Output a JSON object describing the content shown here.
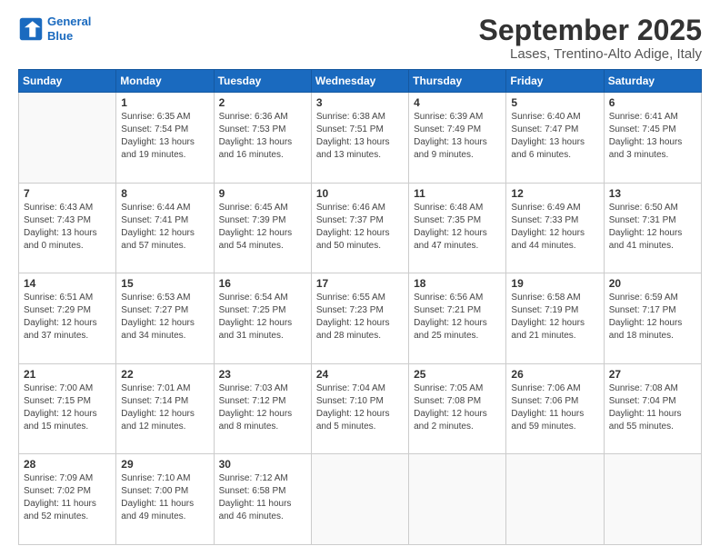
{
  "logo": {
    "line1": "General",
    "line2": "Blue"
  },
  "title": "September 2025",
  "subtitle": "Lases, Trentino-Alto Adige, Italy",
  "headers": [
    "Sunday",
    "Monday",
    "Tuesday",
    "Wednesday",
    "Thursday",
    "Friday",
    "Saturday"
  ],
  "weeks": [
    [
      {
        "day": "",
        "detail": ""
      },
      {
        "day": "1",
        "detail": "Sunrise: 6:35 AM\nSunset: 7:54 PM\nDaylight: 13 hours\nand 19 minutes."
      },
      {
        "day": "2",
        "detail": "Sunrise: 6:36 AM\nSunset: 7:53 PM\nDaylight: 13 hours\nand 16 minutes."
      },
      {
        "day": "3",
        "detail": "Sunrise: 6:38 AM\nSunset: 7:51 PM\nDaylight: 13 hours\nand 13 minutes."
      },
      {
        "day": "4",
        "detail": "Sunrise: 6:39 AM\nSunset: 7:49 PM\nDaylight: 13 hours\nand 9 minutes."
      },
      {
        "day": "5",
        "detail": "Sunrise: 6:40 AM\nSunset: 7:47 PM\nDaylight: 13 hours\nand 6 minutes."
      },
      {
        "day": "6",
        "detail": "Sunrise: 6:41 AM\nSunset: 7:45 PM\nDaylight: 13 hours\nand 3 minutes."
      }
    ],
    [
      {
        "day": "7",
        "detail": "Sunrise: 6:43 AM\nSunset: 7:43 PM\nDaylight: 13 hours\nand 0 minutes."
      },
      {
        "day": "8",
        "detail": "Sunrise: 6:44 AM\nSunset: 7:41 PM\nDaylight: 12 hours\nand 57 minutes."
      },
      {
        "day": "9",
        "detail": "Sunrise: 6:45 AM\nSunset: 7:39 PM\nDaylight: 12 hours\nand 54 minutes."
      },
      {
        "day": "10",
        "detail": "Sunrise: 6:46 AM\nSunset: 7:37 PM\nDaylight: 12 hours\nand 50 minutes."
      },
      {
        "day": "11",
        "detail": "Sunrise: 6:48 AM\nSunset: 7:35 PM\nDaylight: 12 hours\nand 47 minutes."
      },
      {
        "day": "12",
        "detail": "Sunrise: 6:49 AM\nSunset: 7:33 PM\nDaylight: 12 hours\nand 44 minutes."
      },
      {
        "day": "13",
        "detail": "Sunrise: 6:50 AM\nSunset: 7:31 PM\nDaylight: 12 hours\nand 41 minutes."
      }
    ],
    [
      {
        "day": "14",
        "detail": "Sunrise: 6:51 AM\nSunset: 7:29 PM\nDaylight: 12 hours\nand 37 minutes."
      },
      {
        "day": "15",
        "detail": "Sunrise: 6:53 AM\nSunset: 7:27 PM\nDaylight: 12 hours\nand 34 minutes."
      },
      {
        "day": "16",
        "detail": "Sunrise: 6:54 AM\nSunset: 7:25 PM\nDaylight: 12 hours\nand 31 minutes."
      },
      {
        "day": "17",
        "detail": "Sunrise: 6:55 AM\nSunset: 7:23 PM\nDaylight: 12 hours\nand 28 minutes."
      },
      {
        "day": "18",
        "detail": "Sunrise: 6:56 AM\nSunset: 7:21 PM\nDaylight: 12 hours\nand 25 minutes."
      },
      {
        "day": "19",
        "detail": "Sunrise: 6:58 AM\nSunset: 7:19 PM\nDaylight: 12 hours\nand 21 minutes."
      },
      {
        "day": "20",
        "detail": "Sunrise: 6:59 AM\nSunset: 7:17 PM\nDaylight: 12 hours\nand 18 minutes."
      }
    ],
    [
      {
        "day": "21",
        "detail": "Sunrise: 7:00 AM\nSunset: 7:15 PM\nDaylight: 12 hours\nand 15 minutes."
      },
      {
        "day": "22",
        "detail": "Sunrise: 7:01 AM\nSunset: 7:14 PM\nDaylight: 12 hours\nand 12 minutes."
      },
      {
        "day": "23",
        "detail": "Sunrise: 7:03 AM\nSunset: 7:12 PM\nDaylight: 12 hours\nand 8 minutes."
      },
      {
        "day": "24",
        "detail": "Sunrise: 7:04 AM\nSunset: 7:10 PM\nDaylight: 12 hours\nand 5 minutes."
      },
      {
        "day": "25",
        "detail": "Sunrise: 7:05 AM\nSunset: 7:08 PM\nDaylight: 12 hours\nand 2 minutes."
      },
      {
        "day": "26",
        "detail": "Sunrise: 7:06 AM\nSunset: 7:06 PM\nDaylight: 11 hours\nand 59 minutes."
      },
      {
        "day": "27",
        "detail": "Sunrise: 7:08 AM\nSunset: 7:04 PM\nDaylight: 11 hours\nand 55 minutes."
      }
    ],
    [
      {
        "day": "28",
        "detail": "Sunrise: 7:09 AM\nSunset: 7:02 PM\nDaylight: 11 hours\nand 52 minutes."
      },
      {
        "day": "29",
        "detail": "Sunrise: 7:10 AM\nSunset: 7:00 PM\nDaylight: 11 hours\nand 49 minutes."
      },
      {
        "day": "30",
        "detail": "Sunrise: 7:12 AM\nSunset: 6:58 PM\nDaylight: 11 hours\nand 46 minutes."
      },
      {
        "day": "",
        "detail": ""
      },
      {
        "day": "",
        "detail": ""
      },
      {
        "day": "",
        "detail": ""
      },
      {
        "day": "",
        "detail": ""
      }
    ]
  ]
}
